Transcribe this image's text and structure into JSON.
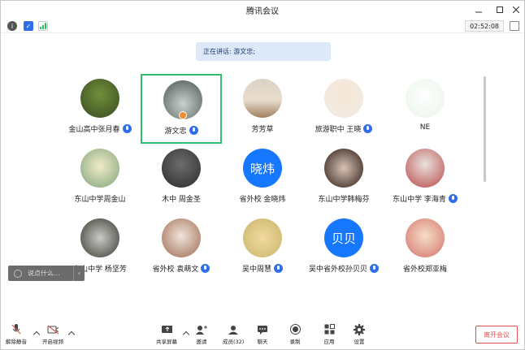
{
  "window": {
    "title": "腾讯会议"
  },
  "toolbar": {
    "timer": "02:52:08",
    "icons": [
      "info-icon",
      "shield-icon",
      "signal-icon"
    ]
  },
  "banner": {
    "speaking_text": "正在讲话: 游文忠;"
  },
  "participants": [
    {
      "name": "金山高中张月春",
      "mic": true,
      "avatar": "photo-plant"
    },
    {
      "name": "游文忠",
      "mic": true,
      "avatar": "photo-cap",
      "active": true
    },
    {
      "name": "芳芳草",
      "mic": false,
      "avatar": "photo-desert"
    },
    {
      "name": "旅游职中 王晓",
      "mic": true,
      "avatar": "cartoon-girl"
    },
    {
      "name": "NE",
      "mic": false,
      "avatar": "cartoon-face"
    },
    {
      "name": "东山中学周金山",
      "mic": false,
      "avatar": "cartoon-boy"
    },
    {
      "name": "木中  周金圣",
      "mic": false,
      "avatar": "photo-man"
    },
    {
      "name": "省外校 金晓炜",
      "mic": false,
      "avatar_text": "晓炜"
    },
    {
      "name": "东山中学韩梅芬",
      "mic": false,
      "avatar": "photo-flower"
    },
    {
      "name": "东山中学 李海青",
      "mic": true,
      "avatar": "photo-woman"
    },
    {
      "name": "东山中学  杨坚芳",
      "mic": false,
      "avatar": "photo-tree"
    },
    {
      "name": "省外校 袁萌文",
      "mic": true,
      "avatar": "drawing-woman"
    },
    {
      "name": "吴中周慧",
      "mic": true,
      "avatar": "photo-child"
    },
    {
      "name": "吴中省外校孙贝贝",
      "mic": true,
      "avatar_text": "贝贝"
    },
    {
      "name": "省外校郑亚梅",
      "mic": false,
      "avatar": "photo-baby"
    }
  ],
  "chat": {
    "placeholder": "说点什么..."
  },
  "bottom": {
    "mute": "解除静音",
    "video": "开启视频",
    "share": "共享屏幕",
    "invite": "邀请",
    "members": "成员(32)",
    "chat": "聊天",
    "record": "录制",
    "apps": "应用",
    "settings": "设置",
    "leave": "离开会议"
  }
}
